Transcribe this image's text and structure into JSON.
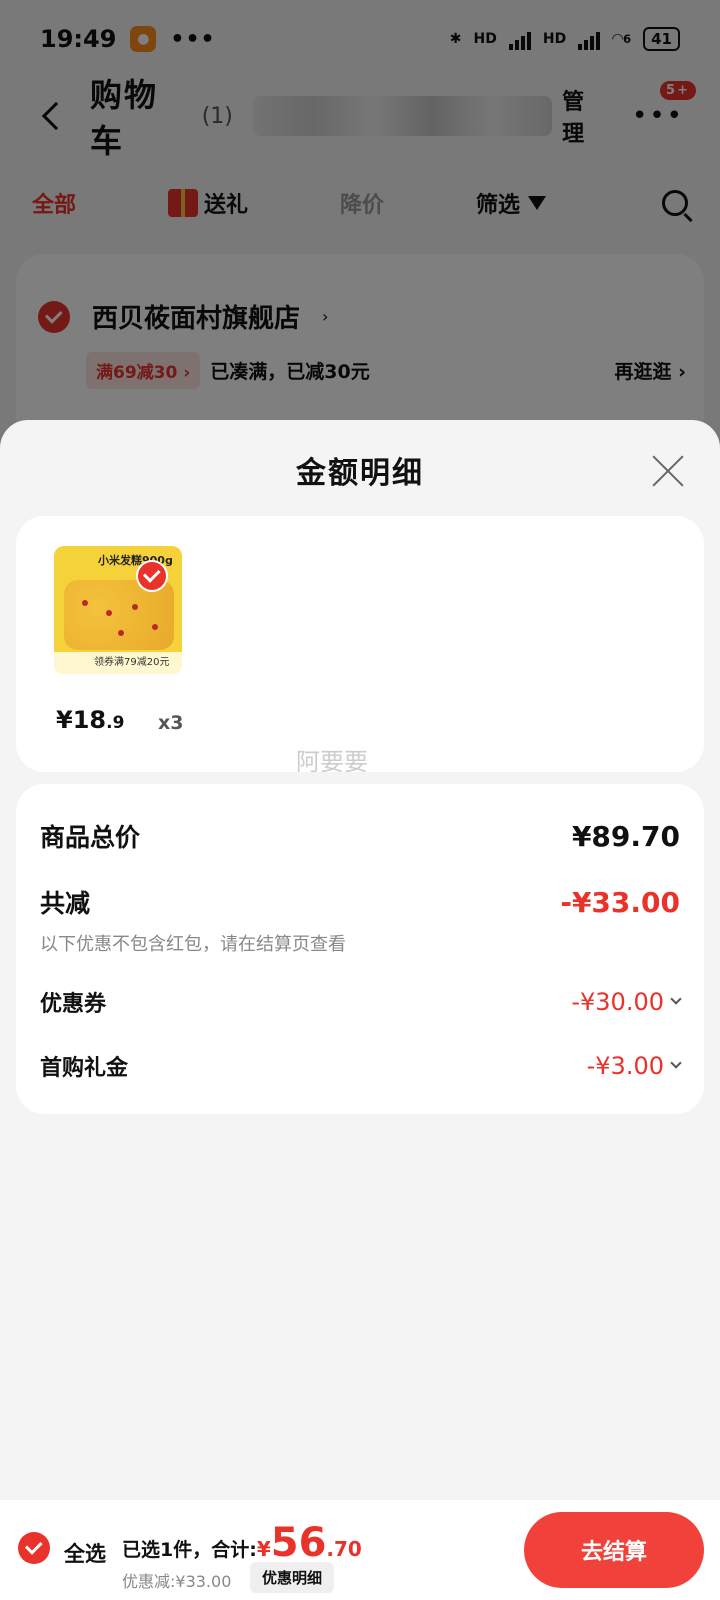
{
  "status_bar": {
    "time": "19:49",
    "dots": "•••",
    "net1": "HD",
    "net2": "HD",
    "wifi_sub": "6",
    "battery": "41"
  },
  "header": {
    "title": "购物车",
    "count": "(1)",
    "manage": "管理",
    "more": "•••",
    "badge": "5+"
  },
  "filters": {
    "all": "全部",
    "gift": "送礼",
    "price_drop": "降价",
    "filter": "筛选"
  },
  "shop": {
    "name": "西贝莜面村旗舰店",
    "promo_tag": "满69减30",
    "promo_text": "已凑满，已减30元",
    "promo_more": "再逛逛"
  },
  "sheet": {
    "title": "金额明细",
    "product": {
      "thumb_label": "小米发糕900g",
      "thumb_strip": "领券满79减20元",
      "price_int": "¥18",
      "price_dec": ".9",
      "qty": "x3"
    },
    "watermark": "阿要要",
    "total_label": "商品总价",
    "total_value": "¥89.70",
    "reduce_label": "共减",
    "reduce_value": "-¥33.00",
    "reduce_note": "以下优惠不包含红包，请在结算页查看",
    "coupon_label": "优惠券",
    "coupon_value": "-¥30.00",
    "firstbuy_label": "首购礼金",
    "firstbuy_value": "-¥3.00"
  },
  "bottom": {
    "select_all": "全选",
    "summary": "已选1件，合计:",
    "yen": "¥",
    "amount_int": "56",
    "amount_dec": ".70",
    "discount": "优惠减:¥33.00",
    "detail_btn": "优惠明细",
    "checkout": "去结算"
  },
  "colors": {
    "accent": "#e8322a",
    "overlay": "rgba(0,0,0,0.5)"
  }
}
